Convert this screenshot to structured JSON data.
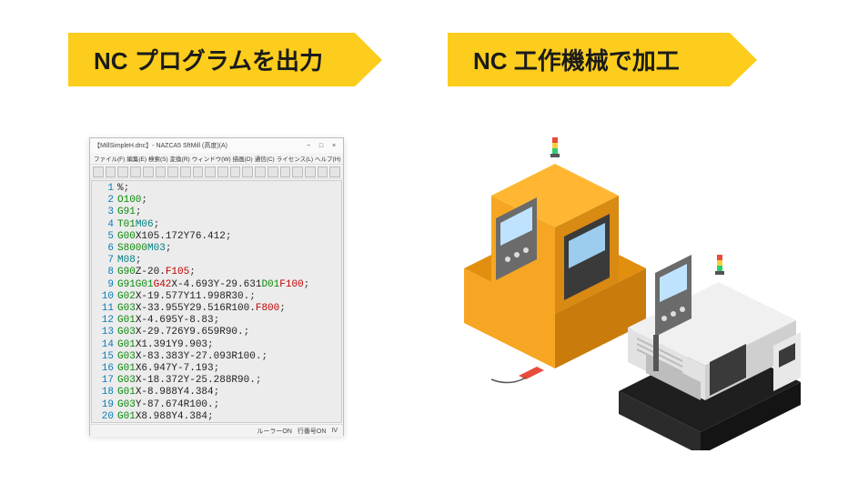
{
  "banners": {
    "left": "NC プログラムを出力",
    "right": "NC 工作機械で加工"
  },
  "editor": {
    "title": "【MillSimpleH.dnc】- NAZCA5 SftMill (高度)(A)",
    "win_controls": {
      "min": "−",
      "max": "□",
      "close": "×"
    },
    "menus": [
      "ファイル(F)",
      "編集(E)",
      "検索(S)",
      "変換(R)",
      "ウィンドウ(W)",
      "描画(D)",
      "通信(C)",
      "ライセンス(L)",
      "ヘルプ(H)"
    ],
    "status": {
      "a": "ルーラーON",
      "b": "行番号ON",
      "c": "IV"
    },
    "toolbar_icons": [
      "new",
      "open",
      "save",
      "print",
      "cut",
      "copy",
      "paste",
      "undo",
      "redo",
      "find",
      "zoom",
      "grid",
      "run",
      "prev",
      "next",
      "stop",
      "sep",
      "link",
      "mail",
      "help"
    ],
    "lines": [
      {
        "n": 1,
        "raw": "%",
        "tokens": [
          [
            "coord",
            "%"
          ],
          [
            "semi",
            ";"
          ]
        ]
      },
      {
        "n": 2,
        "raw": "O100;",
        "tokens": [
          [
            "gword",
            "O100"
          ],
          [
            "semi",
            ";"
          ]
        ]
      },
      {
        "n": 3,
        "raw": "G91;",
        "tokens": [
          [
            "gword",
            "G91"
          ],
          [
            "semi",
            ";"
          ]
        ]
      },
      {
        "n": 4,
        "raw": "T01M06;",
        "tokens": [
          [
            "gword",
            "T01"
          ],
          [
            "mword",
            "M06"
          ],
          [
            "semi",
            ";"
          ]
        ]
      },
      {
        "n": 5,
        "raw": "G00X105.172Y76.412;",
        "tokens": [
          [
            "gword",
            "G00"
          ],
          [
            "coord",
            "X105.172Y76.412"
          ],
          [
            "semi",
            ";"
          ]
        ]
      },
      {
        "n": 6,
        "raw": "S8000M03;",
        "tokens": [
          [
            "gword",
            "S8000"
          ],
          [
            "mword",
            "M03"
          ],
          [
            "semi",
            ";"
          ]
        ]
      },
      {
        "n": 7,
        "raw": "M08;",
        "tokens": [
          [
            "mword",
            "M08"
          ],
          [
            "semi",
            ";"
          ]
        ]
      },
      {
        "n": 8,
        "raw": "G90Z-20.F105;",
        "tokens": [
          [
            "gword",
            "G90"
          ],
          [
            "coord",
            "Z-20."
          ],
          [
            "fword",
            "F105"
          ],
          [
            "semi",
            ";"
          ]
        ]
      },
      {
        "n": 9,
        "raw": "G91G01G42X-4.693Y-29.631D01F100;",
        "tokens": [
          [
            "gword",
            "G91G01"
          ],
          [
            "fword",
            "G42"
          ],
          [
            "coord",
            "X-4.693Y-29.631"
          ],
          [
            "gword",
            "D01"
          ],
          [
            "fword",
            "F100"
          ],
          [
            "semi",
            ";"
          ]
        ]
      },
      {
        "n": 10,
        "raw": "G02X-19.577Y11.998R30.;",
        "tokens": [
          [
            "gword",
            "G02"
          ],
          [
            "coord",
            "X-19.577Y11.998R30."
          ],
          [
            "semi",
            ";"
          ]
        ]
      },
      {
        "n": 11,
        "raw": "G03X-33.955Y29.516R100.F800;",
        "tokens": [
          [
            "gword",
            "G03"
          ],
          [
            "coord",
            "X-33.955Y29.516R100."
          ],
          [
            "fword",
            "F800"
          ],
          [
            "semi",
            ";"
          ]
        ]
      },
      {
        "n": 12,
        "raw": "G01X-4.695Y-8.83;",
        "tokens": [
          [
            "gword",
            "G01"
          ],
          [
            "coord",
            "X-4.695Y-8.83"
          ],
          [
            "semi",
            ";"
          ]
        ]
      },
      {
        "n": 13,
        "raw": "G03X-29.726Y9.659R90.;",
        "tokens": [
          [
            "gword",
            "G03"
          ],
          [
            "coord",
            "X-29.726Y9.659R90."
          ],
          [
            "semi",
            ";"
          ]
        ]
      },
      {
        "n": 14,
        "raw": "G01X1.391Y9.903;",
        "tokens": [
          [
            "gword",
            "G01"
          ],
          [
            "coord",
            "X1.391Y9.903"
          ],
          [
            "semi",
            ";"
          ]
        ]
      },
      {
        "n": 15,
        "raw": "G03X-83.383Y-27.093R100.;",
        "tokens": [
          [
            "gword",
            "G03"
          ],
          [
            "coord",
            "X-83.383Y-27.093R100."
          ],
          [
            "semi",
            ";"
          ]
        ]
      },
      {
        "n": 16,
        "raw": "G01X6.947Y-7.193;",
        "tokens": [
          [
            "gword",
            "G01"
          ],
          [
            "coord",
            "X6.947Y-7.193"
          ],
          [
            "semi",
            ";"
          ]
        ]
      },
      {
        "n": 17,
        "raw": "G03X-18.372Y-25.288R90.;",
        "tokens": [
          [
            "gword",
            "G03"
          ],
          [
            "coord",
            "X-18.372Y-25.288R90."
          ],
          [
            "semi",
            ";"
          ]
        ]
      },
      {
        "n": 18,
        "raw": "G01X-8.988Y4.384;",
        "tokens": [
          [
            "gword",
            "G01"
          ],
          [
            "coord",
            "X-8.988Y4.384"
          ],
          [
            "semi",
            ";"
          ]
        ]
      },
      {
        "n": 19,
        "raw": "G03Y-87.674R100.;",
        "tokens": [
          [
            "gword",
            "G03"
          ],
          [
            "coord",
            "Y-87.674R100."
          ],
          [
            "semi",
            ";"
          ]
        ]
      },
      {
        "n": 20,
        "raw": "G01X8.988Y4.384;",
        "tokens": [
          [
            "gword",
            "G01"
          ],
          [
            "coord",
            "X8.988Y4.384"
          ],
          [
            "semi",
            ";"
          ]
        ]
      }
    ]
  },
  "machines": {
    "description": "Two isometric CNC machines: an orange vertical machining center (left) and a grey/black CNC lathe (right)",
    "orange_machine": {
      "color_body": "#f6a623",
      "color_panel": "#6b6b6b",
      "beacon": [
        "#e74c3c",
        "#f4d03f",
        "#2ecc71"
      ]
    },
    "grey_machine": {
      "color_body": "#e8e8e8",
      "color_base": "#2b2b2b",
      "beacon": [
        "#e74c3c",
        "#f4d03f",
        "#2ecc71"
      ]
    }
  }
}
